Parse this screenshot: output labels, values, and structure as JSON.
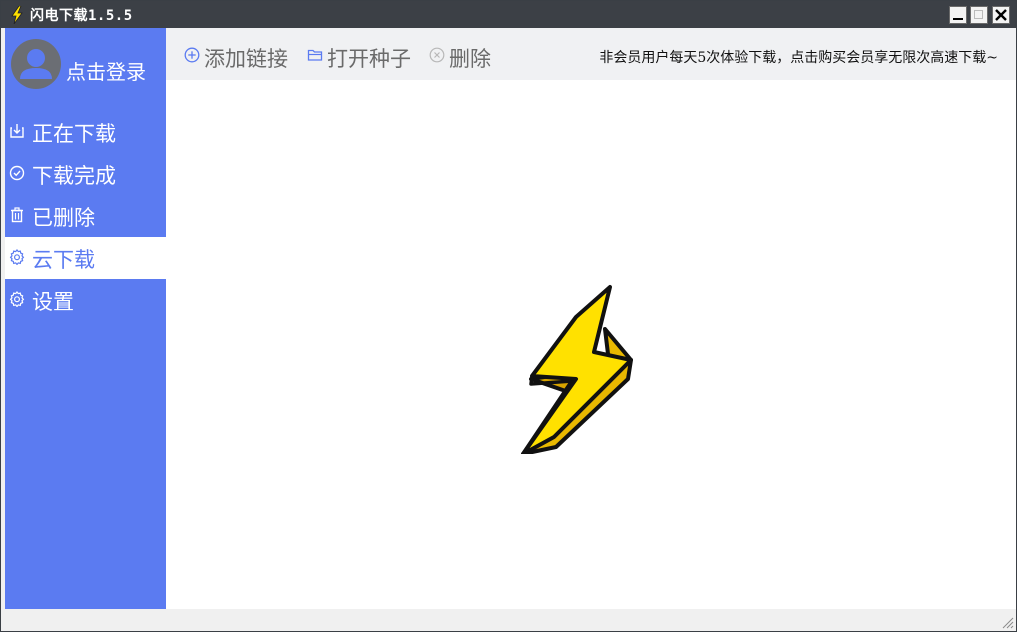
{
  "window": {
    "title": "闪电下载1.5.5",
    "app_icon": "lightning-icon"
  },
  "sidebar": {
    "login_label": "点击登录",
    "items": [
      {
        "label": "正在下载",
        "icon": "download-icon",
        "active": false
      },
      {
        "label": "下载完成",
        "icon": "check-circle-icon",
        "active": false
      },
      {
        "label": "已删除",
        "icon": "trash-icon",
        "active": false
      },
      {
        "label": "云下载",
        "icon": "gear-icon",
        "active": true
      },
      {
        "label": "设置",
        "icon": "gear-icon",
        "active": false
      }
    ]
  },
  "toolbar": {
    "add_link_label": "添加链接",
    "open_torrent_label": "打开种子",
    "delete_label": "删除",
    "promo_text": "非会员用户每天5次体验下载，点击购买会员享无限次高速下载~"
  },
  "colors": {
    "sidebar": "#5b7bf1",
    "titlebar": "#3c4046",
    "active_text": "#5b7bf1",
    "toolbar_bg": "#f0f1f3",
    "bolt_yellow": "#ffe100"
  }
}
